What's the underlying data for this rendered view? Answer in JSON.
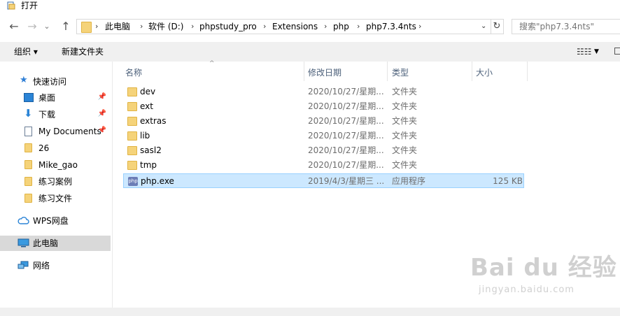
{
  "window": {
    "title": "打开"
  },
  "nav": {
    "back": "←",
    "forward": "→",
    "dropdown": "⌄",
    "up": "↑",
    "refresh": "↻"
  },
  "breadcrumb": [
    "此电脑",
    "软件 (D:)",
    "phpstudy_pro",
    "Extensions",
    "php",
    "php7.3.4nts"
  ],
  "search": {
    "placeholder": "搜索\"php7.3.4nts\""
  },
  "toolbar": {
    "organize": "组织 ▾",
    "new_folder": "新建文件夹",
    "view": "☷☷"
  },
  "sidebar": {
    "items": [
      {
        "label": "快速访问",
        "icon": "star-icon"
      },
      {
        "label": "桌面",
        "icon": "desktop-icon",
        "pinned": true
      },
      {
        "label": "下载",
        "icon": "download-icon",
        "pinned": true
      },
      {
        "label": "My Documents",
        "icon": "document-icon",
        "pinned": true
      },
      {
        "label": "26",
        "icon": "folder-icon"
      },
      {
        "label": "Mike_gao",
        "icon": "folder-icon"
      },
      {
        "label": "练习案例",
        "icon": "folder-icon"
      },
      {
        "label": "练习文件",
        "icon": "folder-icon"
      },
      {
        "label": "WPS网盘",
        "icon": "cloud-icon"
      },
      {
        "label": "此电脑",
        "icon": "computer-icon",
        "selected": true
      },
      {
        "label": "网络",
        "icon": "network-icon"
      }
    ]
  },
  "columns": {
    "name": "名称",
    "modified": "修改日期",
    "type": "类型",
    "size": "大小"
  },
  "files": [
    {
      "name": "dev",
      "modified": "2020/10/27/星期...",
      "type": "文件夹",
      "size": ""
    },
    {
      "name": "ext",
      "modified": "2020/10/27/星期...",
      "type": "文件夹",
      "size": ""
    },
    {
      "name": "extras",
      "modified": "2020/10/27/星期...",
      "type": "文件夹",
      "size": ""
    },
    {
      "name": "lib",
      "modified": "2020/10/27/星期...",
      "type": "文件夹",
      "size": ""
    },
    {
      "name": "sasl2",
      "modified": "2020/10/27/星期...",
      "type": "文件夹",
      "size": ""
    },
    {
      "name": "tmp",
      "modified": "2020/10/27/星期...",
      "type": "文件夹",
      "size": ""
    },
    {
      "name": "php.exe",
      "modified": "2019/4/3/星期三 ...",
      "type": "应用程序",
      "size": "125 KB",
      "selected": true
    }
  ],
  "watermark": {
    "main": "Bai du 经验",
    "sub": "jingyan.baidu.com"
  }
}
